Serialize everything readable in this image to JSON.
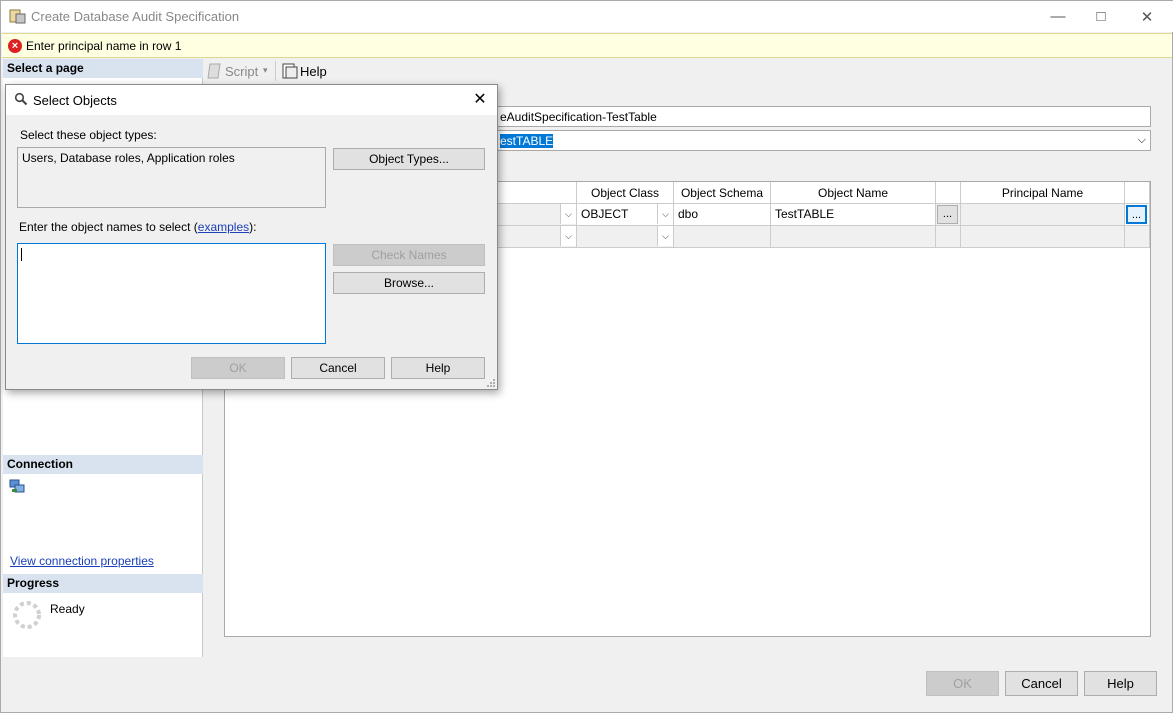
{
  "window": {
    "title": "Create Database Audit Specification",
    "minimize_icon": "minimize-icon",
    "maximize_icon": "maximize-icon",
    "close_icon": "close-icon"
  },
  "error_bar": {
    "message": "Enter principal name in row 1"
  },
  "left_pane": {
    "select_page_header": "Select a page",
    "connection_header": "Connection",
    "view_connection_link": "View connection properties",
    "progress_header": "Progress",
    "progress_status": "Ready"
  },
  "toolbar": {
    "script_label": "Script",
    "help_label": "Help"
  },
  "form": {
    "name_value": "eAuditSpecification-TestTable",
    "audit_value": "estTABLE"
  },
  "grid": {
    "headers": [
      "Object Class",
      "Object Schema",
      "Object Name",
      "Principal Name"
    ],
    "rows": [
      {
        "object_class": "OBJECT",
        "object_schema": "dbo",
        "object_name": "TestTABLE",
        "principal_name": ""
      },
      {
        "object_class": "",
        "object_schema": "",
        "object_name": "",
        "principal_name": ""
      }
    ],
    "ellipsis": "..."
  },
  "bottom_buttons": {
    "ok": "OK",
    "cancel": "Cancel",
    "help": "Help"
  },
  "dialog": {
    "title": "Select Objects",
    "object_types_label": "Select these object types:",
    "object_types_value": "Users, Database roles, Application roles",
    "object_types_button": "Object Types...",
    "names_label_prefix": "Enter the object names to select (",
    "names_label_link": "examples",
    "names_label_suffix": "):",
    "names_value": "",
    "check_names_button": "Check Names",
    "browse_button": "Browse...",
    "ok_button": "OK",
    "cancel_button": "Cancel",
    "help_button": "Help"
  },
  "colors": {
    "error_bar": "#ffffe1",
    "section_header": "#d9e3ef",
    "selection": "#0078d7",
    "link": "#1a3fb8"
  }
}
